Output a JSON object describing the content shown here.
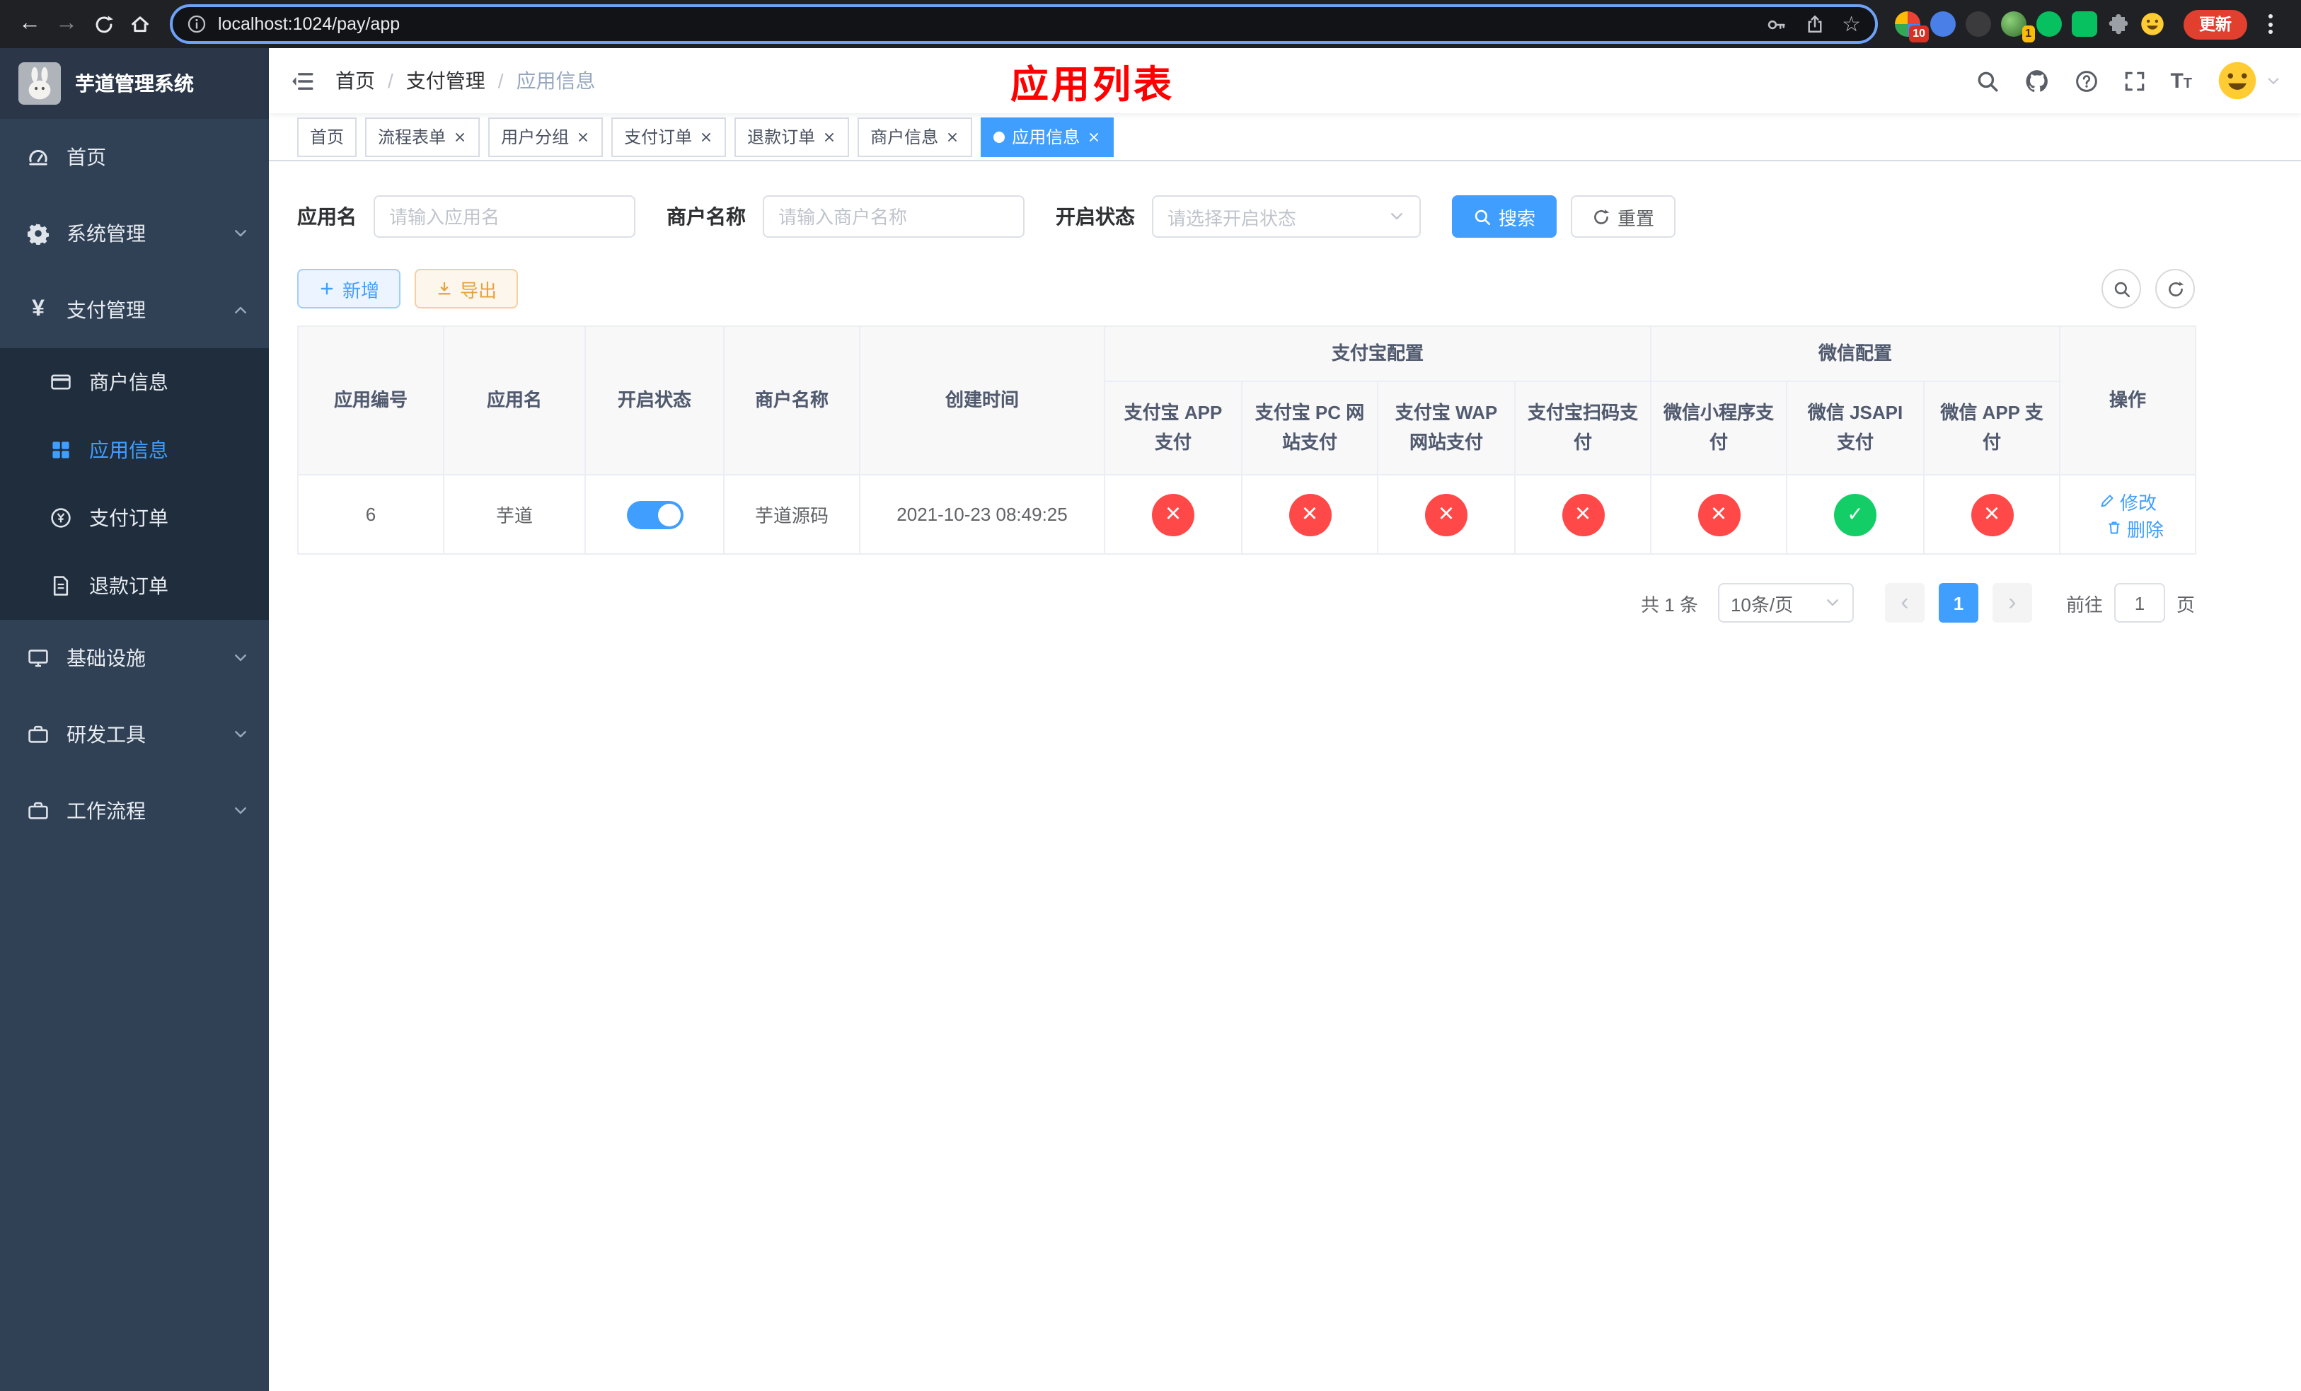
{
  "browser": {
    "url": "localhost:1024/pay/app",
    "update_label": "更新",
    "extension_badge_1": "10",
    "extension_badge_2": "1",
    "icons": [
      "back-arrow",
      "forward-arrow",
      "reload",
      "home",
      "site-info",
      "key",
      "share",
      "bookmark-star",
      "extensions-puzzle",
      "profile-emoji",
      "menu-dots"
    ]
  },
  "sidebar": {
    "app_title": "芋道管理系统",
    "items": [
      {
        "label": "首页",
        "icon": "dashboard-icon"
      },
      {
        "label": "系统管理",
        "icon": "gear-icon"
      },
      {
        "label": "支付管理",
        "icon": "yen-icon"
      },
      {
        "label": "商户信息",
        "icon": "merchant-card-icon"
      },
      {
        "label": "应用信息",
        "icon": "app-grid-icon"
      },
      {
        "label": "支付订单",
        "icon": "pay-order-icon"
      },
      {
        "label": "退款订单",
        "icon": "refund-doc-icon"
      },
      {
        "label": "基础设施",
        "icon": "infrastructure-icon"
      },
      {
        "label": "研发工具",
        "icon": "dev-tools-icon"
      },
      {
        "label": "工作流程",
        "icon": "workflow-icon"
      }
    ]
  },
  "navbar": {
    "breadcrumb": [
      "首页",
      "支付管理",
      "应用信息"
    ],
    "page_title": "应用列表",
    "icons": [
      "search-icon",
      "github-icon",
      "question-icon",
      "fullscreen-icon",
      "font-size-icon",
      "avatar",
      "caret-down-icon"
    ]
  },
  "tabs": [
    {
      "label": "首页"
    },
    {
      "label": "流程表单"
    },
    {
      "label": "用户分组"
    },
    {
      "label": "支付订单"
    },
    {
      "label": "退款订单"
    },
    {
      "label": "商户信息"
    },
    {
      "label": "应用信息"
    }
  ],
  "filters": {
    "app_name_label": "应用名",
    "app_name_placeholder": "请输入应用名",
    "merchant_label": "商户名称",
    "merchant_placeholder": "请输入商户名称",
    "status_label": "开启状态",
    "status_placeholder": "请选择开启状态",
    "search_label": "搜索",
    "reset_label": "重置"
  },
  "toolbar": {
    "add_label": "新增",
    "export_label": "导出"
  },
  "table": {
    "headers": {
      "app_id": "应用编号",
      "app_name": "应用名",
      "status": "开启状态",
      "merchant": "商户名称",
      "create_time": "创建时间",
      "alipay_group": "支付宝配置",
      "wechat_group": "微信配置",
      "alipay_app": "支付宝 APP 支付",
      "alipay_pc": "支付宝 PC 网站支付",
      "alipay_wap": "支付宝 WAP 网站支付",
      "alipay_qr": "支付宝扫码支付",
      "wx_mini": "微信小程序支付",
      "wx_jsapi": "微信 JSAPI 支付",
      "wx_app": "微信 APP 支付",
      "actions": "操作"
    },
    "actions": {
      "edit": "修改",
      "delete": "删除"
    },
    "rows": [
      {
        "app_id": "6",
        "app_name": "芋道",
        "status_on": true,
        "merchant": "芋道源码",
        "create_time": "2021-10-23 08:49:25",
        "alipay_app": false,
        "alipay_pc": false,
        "alipay_wap": false,
        "alipay_qr": false,
        "wx_mini": false,
        "wx_jsapi": true,
        "wx_app": false
      }
    ]
  },
  "pagination": {
    "total_text": "共 1 条",
    "page_size": "10条/页",
    "current_page": "1",
    "goto_prefix": "前往",
    "goto_value": "1",
    "goto_suffix": "页"
  },
  "colors": {
    "primary": "#409eff",
    "success": "#13ce66",
    "danger": "#ff4949",
    "page_title_red": "#ff0000",
    "sidebar_bg": "#304156",
    "submenu_bg": "#1f2d3d"
  }
}
